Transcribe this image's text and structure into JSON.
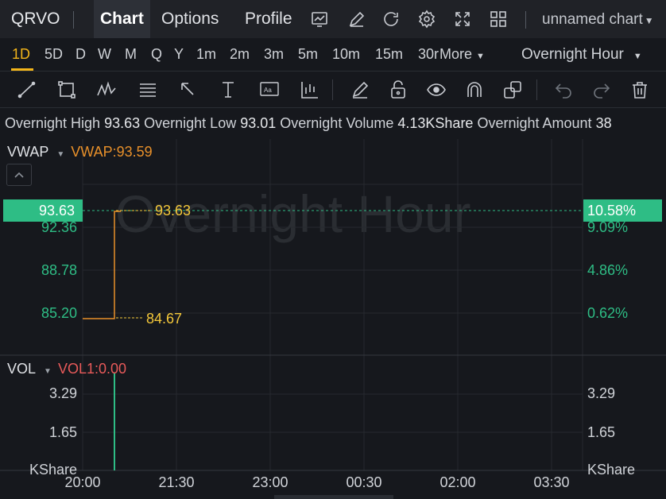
{
  "header": {
    "symbol": "QRVO",
    "tabs": [
      {
        "label": "Chart",
        "active": true
      },
      {
        "label": "Options",
        "active": false
      },
      {
        "label": "Profile",
        "active": false
      }
    ],
    "icons": [
      "chart-type-icon",
      "draw-pen-icon",
      "refresh-icon",
      "settings-icon",
      "fullscreen-icon",
      "layout-grid-icon"
    ],
    "chart_name": "unnamed chart"
  },
  "intervals": {
    "items": [
      "1D",
      "5D",
      "D",
      "W",
      "M",
      "Q",
      "Y",
      "1m",
      "2m",
      "3m",
      "5m",
      "10m",
      "15m",
      "30r",
      "More"
    ],
    "active": "1D",
    "session": "Overnight Hour"
  },
  "tools": [
    "trend-line-icon",
    "rectangle-icon",
    "pattern-icon",
    "fib-icon",
    "arrow-icon",
    "measure-icon",
    "text-note-icon",
    "indicator-icon",
    "brush-icon",
    "lock-icon",
    "eye-icon",
    "magnet-icon",
    "layers-icon",
    "undo-icon",
    "redo-icon",
    "trash-icon"
  ],
  "stats": {
    "high_label": "Overnight High",
    "high": "93.63",
    "low_label": "Overnight Low",
    "low": "93.01",
    "volume_label": "Overnight Volume",
    "volume": "4.13KShare",
    "amount_label": "Overnight Amount",
    "amount": "38"
  },
  "main_pane": {
    "indicator": "VWAP",
    "indicator_value": "VWAP:93.59",
    "watermark": "Overnight Hour",
    "current_price": "93.63",
    "current_pct": "10.58%",
    "left_ticks": [
      "92.36",
      "88.78",
      "85.20"
    ],
    "right_ticks": [
      "9.09%",
      "4.86%",
      "0.62%"
    ],
    "high_marker": "93.63",
    "low_marker": "84.67"
  },
  "volume_pane": {
    "indicator": "VOL",
    "indicator_value": "VOL1:0.00",
    "left_ticks": [
      "3.29",
      "1.65",
      "KShare"
    ],
    "right_ticks": [
      "3.29",
      "1.65",
      "KShare"
    ]
  },
  "time_axis": [
    "20:00",
    "21:30",
    "23:00",
    "00:30",
    "02:00",
    "03:30"
  ],
  "colors": {
    "up": "#2ebd85",
    "accent": "#f3b51a",
    "vwap": "#e8902a",
    "vol_value": "#e85a5a"
  }
}
